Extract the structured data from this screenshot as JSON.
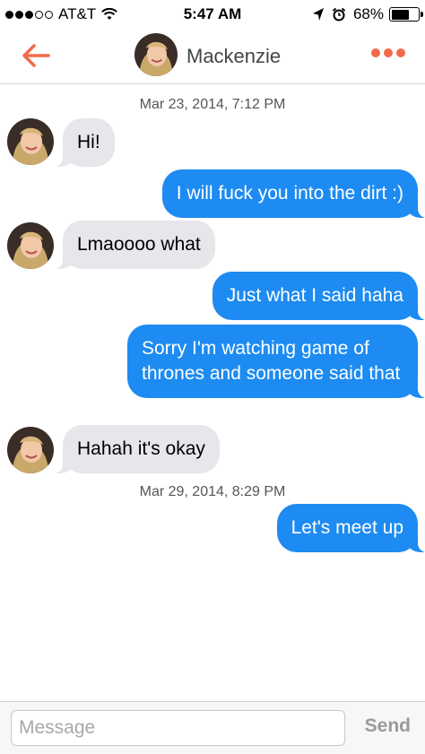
{
  "status_bar": {
    "carrier": "AT&T",
    "time": "5:47 AM",
    "battery": "68%",
    "battery_level": 0.68,
    "signal_bars": 3,
    "signal_total": 5,
    "icons": [
      "wifi-icon",
      "location-arrow-icon",
      "alarm-icon",
      "battery-icon"
    ]
  },
  "nav": {
    "contact_name": "Mackenzie",
    "accent_color": "#f26a4b",
    "icons": [
      "back-arrow-icon",
      "more-dots-icon"
    ]
  },
  "chat": {
    "timestamp_1": "Mar 23, 2014, 7:12 PM",
    "timestamp_2": "Mar 29, 2014, 8:29 PM",
    "messages": [
      {
        "sender": "them",
        "text": "Hi!"
      },
      {
        "sender": "me",
        "text": "I will fuck you into the dirt :)"
      },
      {
        "sender": "them",
        "text": "Lmaoooo what"
      },
      {
        "sender": "me",
        "text": "Just what I said haha"
      },
      {
        "sender": "me",
        "text": "Sorry I'm watching game of thrones and someone said that"
      },
      {
        "sender": "them",
        "text": "Hahah it's okay"
      },
      {
        "sender": "me",
        "text": "Let's meet up"
      }
    ],
    "incoming_color": "#e6e6eb",
    "outgoing_color": "#1d8bf1"
  },
  "composer": {
    "placeholder": "Message",
    "send_label": "Send"
  }
}
